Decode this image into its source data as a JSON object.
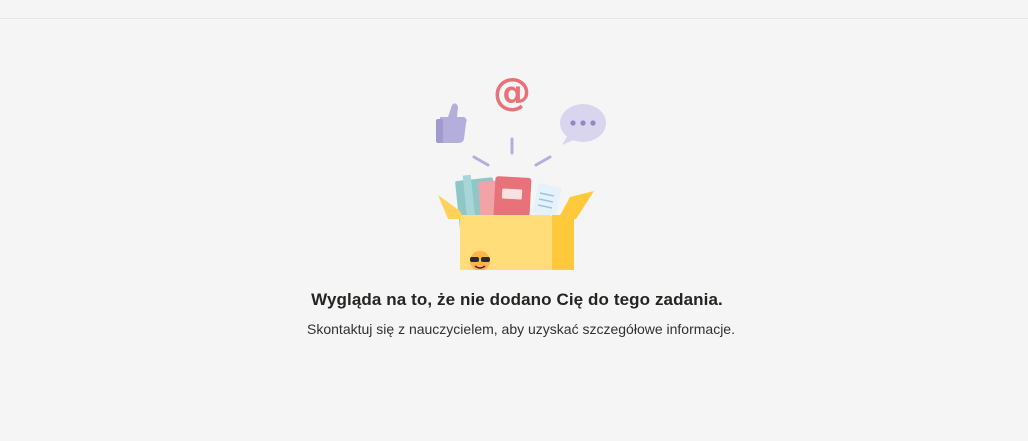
{
  "empty_state": {
    "title": "Wygląda na to, że nie dodano Cię do tego zadania.",
    "subtitle": "Skontaktuj się z nauczycielem, aby uzyskać szczegółowe informacje.",
    "illustration_icon": "open-box-with-books-icon",
    "at_symbol": "@"
  },
  "colors": {
    "background": "#f5f5f5",
    "box": "#ffde7a",
    "box_shade": "#ffc93b",
    "accent_red": "#e8727a",
    "accent_lavender": "#b3aedb"
  }
}
